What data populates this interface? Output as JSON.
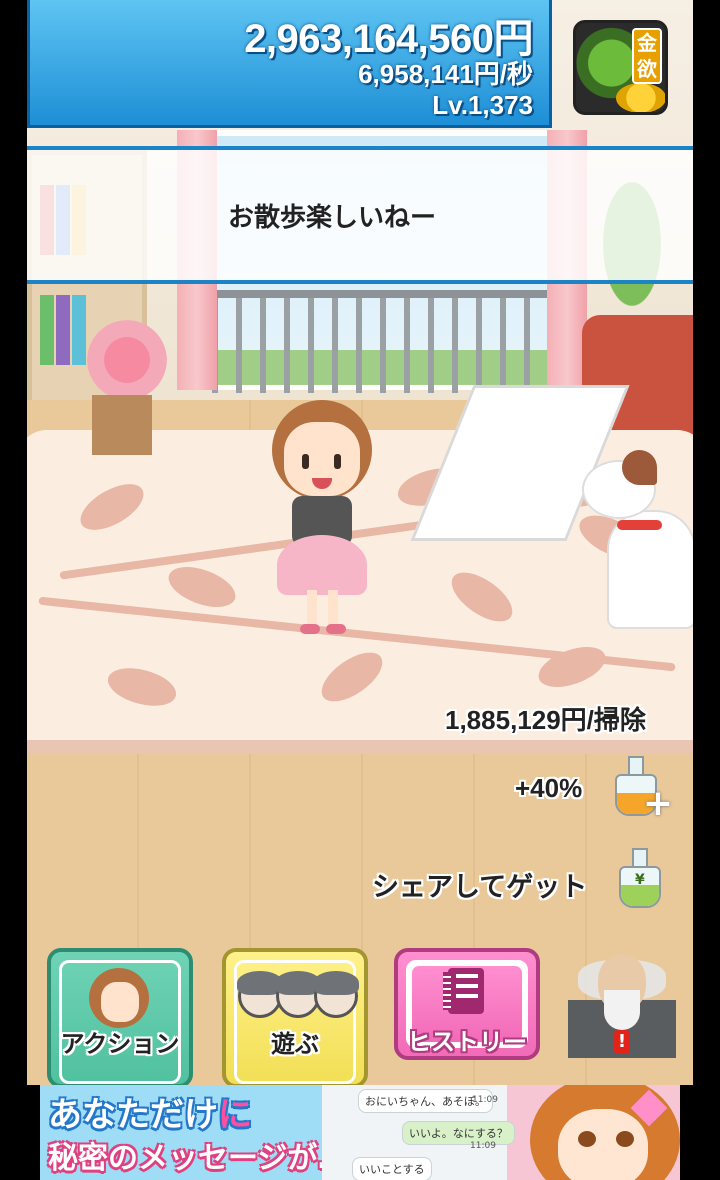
{
  "hud": {
    "money": "2,963,164,560円",
    "rate": "6,958,141円/秒",
    "level": "Lv.1,373"
  },
  "goblin_button": {
    "kanji": [
      "金",
      "欲"
    ]
  },
  "speech": {
    "text": "お散歩楽しいねー"
  },
  "stats": {
    "per_clean": "1,885,129円/掃除",
    "boost": "+40%",
    "share": "シェアしてゲット"
  },
  "buttons": {
    "action": "アクション",
    "play": "遊ぶ",
    "history": "ヒストリー"
  },
  "elder": {
    "alert": "!"
  },
  "ad": {
    "line1_a": "あなただけ",
    "line1_b": "に",
    "line2": "秘密のメッセージが…",
    "chat": [
      {
        "text": "おにいちゃん、あそぼ。",
        "time": "11:09"
      },
      {
        "text": "いいよ。なにする？",
        "time": "11:09"
      },
      {
        "text": "いいことする"
      }
    ]
  },
  "colors": {
    "hud_top": "#5ec4f2",
    "hud_bottom": "#1e8fd6",
    "speech_border": "#1c84c6",
    "action_btn": "#50c19f",
    "play_btn": "#f2df55",
    "history_btn": "#f26bb8"
  },
  "icons": [
    "goblin-icon",
    "flask-plus-icon",
    "flask-yen-icon",
    "notebook-icon",
    "elder-alert-icon"
  ]
}
